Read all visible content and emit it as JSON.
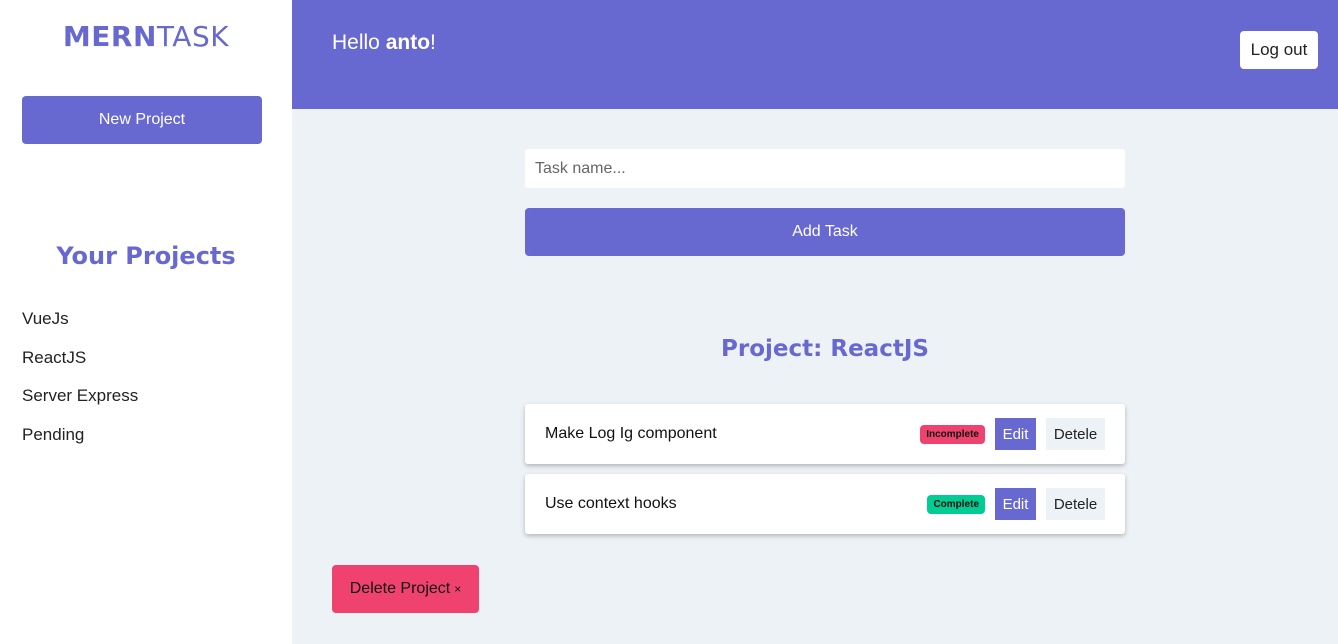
{
  "app": {
    "logo_bold": "MERN",
    "logo_light": "TASK"
  },
  "sidebar": {
    "new_project_label": "New Project",
    "projects_heading": "Your Projects",
    "projects": [
      {
        "label": "VueJs"
      },
      {
        "label": "ReactJS"
      },
      {
        "label": "Server Express"
      },
      {
        "label": "Pending"
      }
    ]
  },
  "header": {
    "greeting_prefix": "Hello ",
    "username": "anto",
    "greeting_suffix": "!",
    "logout_label": "Log out"
  },
  "task_form": {
    "placeholder": "Task name...",
    "value": "",
    "add_label": "Add Task"
  },
  "project": {
    "title": "Project: ReactJS",
    "delete_label": "Delete Project",
    "delete_symbol": "×"
  },
  "tasks": [
    {
      "name": "Make Log Ig component",
      "state": "Incomplete",
      "edit_label": "Edit",
      "delete_label": "Detele"
    },
    {
      "name": "Use context hooks",
      "state": "Complete",
      "edit_label": "Edit",
      "delete_label": "Detele"
    }
  ],
  "colors": {
    "primary": "#6769d0",
    "background": "#edf2f6",
    "incomplete": "#ef426f",
    "complete": "#00cc93",
    "danger": "#ef426f"
  }
}
